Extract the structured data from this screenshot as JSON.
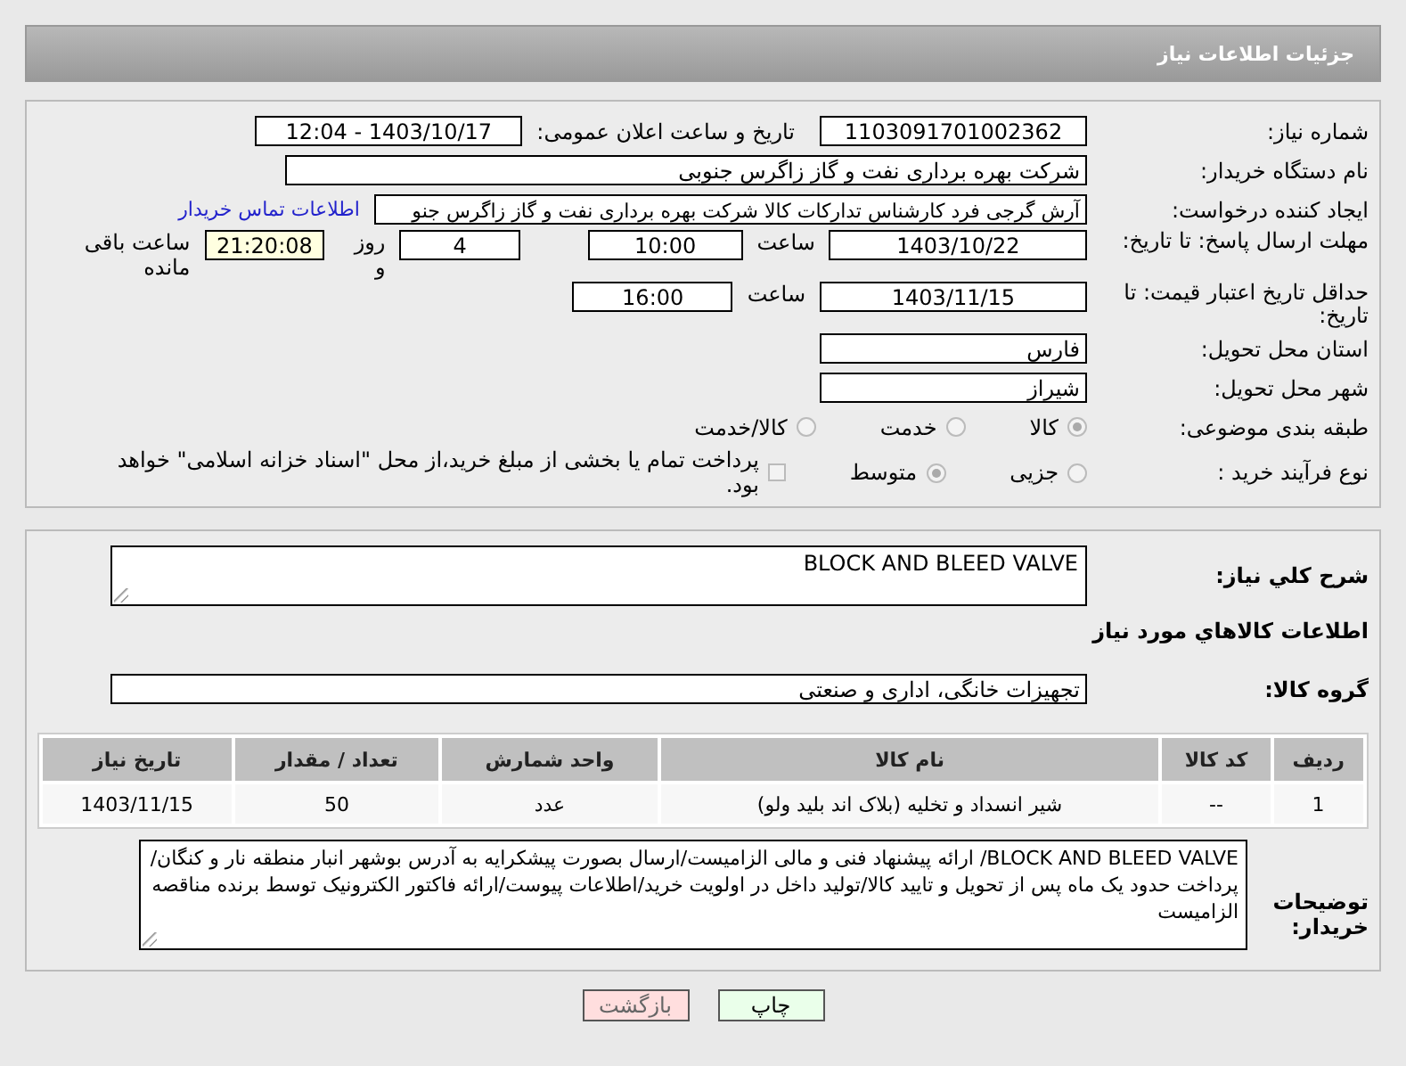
{
  "header": {
    "title": "جزئیات اطلاعات نیاز"
  },
  "details": {
    "need_number": {
      "label": "شماره نیاز:",
      "value": "1103091701002362"
    },
    "announce": {
      "label": "تاریخ و ساعت اعلان عمومی:",
      "value": "1403/10/17 - 12:04"
    },
    "buyer_org": {
      "label": "نام دستگاه خریدار:",
      "value": "شرکت بهره برداری نفت و گاز زاگرس جنوبی"
    },
    "requester": {
      "label": "ایجاد کننده درخواست:",
      "value": "آرش گرجی فرد کارشناس تدارکات کالا شرکت بهره برداری نفت و گاز زاگرس جنو",
      "link": "اطلاعات تماس خریدار"
    },
    "reply_deadline": {
      "label": "مهلت ارسال پاسخ: تا تاریخ:",
      "date": "1403/10/22",
      "time_label": "ساعت",
      "time": "10:00",
      "days": "4",
      "days_label": "روز و",
      "remaining": "21:20:08",
      "remaining_label": "ساعت باقی مانده"
    },
    "price_validity": {
      "label": "حداقل تاریخ اعتبار قیمت: تا تاریخ:",
      "date": "1403/11/15",
      "time_label": "ساعت",
      "time": "16:00"
    },
    "province": {
      "label": "استان محل تحویل:",
      "value": "فارس"
    },
    "city": {
      "label": "شهر محل تحویل:",
      "value": "شیراز"
    },
    "category": {
      "label": "طبقه بندی موضوعی:",
      "options": [
        {
          "label": "کالا",
          "selected": true
        },
        {
          "label": "خدمت",
          "selected": false
        },
        {
          "label": "کالا/خدمت",
          "selected": false
        }
      ]
    },
    "process": {
      "label": "نوع فرآیند خرید :",
      "options": [
        {
          "label": "جزیی",
          "selected": false
        },
        {
          "label": "متوسط",
          "selected": true
        }
      ],
      "payment_checkbox": {
        "label": "پرداخت تمام یا بخشی از مبلغ خرید،از محل \"اسناد خزانه اسلامی\" خواهد بود.",
        "checked": false
      }
    }
  },
  "goods": {
    "description": {
      "label": "شرح کلي نياز:",
      "value": "BLOCK AND BLEED VALVE"
    },
    "section_title": "اطلاعات کالاهاي مورد نياز",
    "group": {
      "label": "گروه کالا:",
      "value": "تجهیزات خانگی، اداری و صنعتی"
    },
    "table": {
      "columns": [
        "ردیف",
        "کد کالا",
        "نام کالا",
        "واحد شمارش",
        "تعداد / مقدار",
        "تاریخ نیاز"
      ],
      "rows": [
        [
          "1",
          "--",
          "شیر انسداد و تخلیه (بلاک اند بلید ولو)",
          "عدد",
          "50",
          "1403/11/15"
        ]
      ]
    },
    "buyer_notes": {
      "label": "توضیحات خریدار:",
      "value": "BLOCK AND BLEED VALVE/ ارائه پیشنهاد فنی و مالی الزامیست/ارسال بصورت پیشکرایه به آدرس بوشهر انبار منطقه نار و کنگان/پرداخت حدود یک ماه پس از تحویل و تایید کالا/تولید داخل در اولویت خرید/اطلاعات پیوست/ارائه فاکتور الکترونیک توسط برنده مناقصه الزامیست"
    }
  },
  "buttons": [
    {
      "label": "چاپ",
      "kind": "print"
    },
    {
      "label": "بازگشت",
      "kind": "back"
    }
  ]
}
